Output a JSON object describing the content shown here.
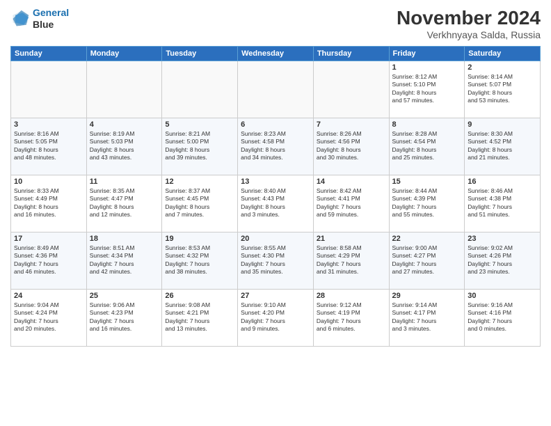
{
  "header": {
    "logo_line1": "General",
    "logo_line2": "Blue",
    "title": "November 2024",
    "subtitle": "Verkhnyaya Salda, Russia"
  },
  "weekdays": [
    "Sunday",
    "Monday",
    "Tuesday",
    "Wednesday",
    "Thursday",
    "Friday",
    "Saturday"
  ],
  "weeks": [
    [
      {
        "day": "",
        "info": ""
      },
      {
        "day": "",
        "info": ""
      },
      {
        "day": "",
        "info": ""
      },
      {
        "day": "",
        "info": ""
      },
      {
        "day": "",
        "info": ""
      },
      {
        "day": "1",
        "info": "Sunrise: 8:12 AM\nSunset: 5:10 PM\nDaylight: 8 hours\nand 57 minutes."
      },
      {
        "day": "2",
        "info": "Sunrise: 8:14 AM\nSunset: 5:07 PM\nDaylight: 8 hours\nand 53 minutes."
      }
    ],
    [
      {
        "day": "3",
        "info": "Sunrise: 8:16 AM\nSunset: 5:05 PM\nDaylight: 8 hours\nand 48 minutes."
      },
      {
        "day": "4",
        "info": "Sunrise: 8:19 AM\nSunset: 5:03 PM\nDaylight: 8 hours\nand 43 minutes."
      },
      {
        "day": "5",
        "info": "Sunrise: 8:21 AM\nSunset: 5:00 PM\nDaylight: 8 hours\nand 39 minutes."
      },
      {
        "day": "6",
        "info": "Sunrise: 8:23 AM\nSunset: 4:58 PM\nDaylight: 8 hours\nand 34 minutes."
      },
      {
        "day": "7",
        "info": "Sunrise: 8:26 AM\nSunset: 4:56 PM\nDaylight: 8 hours\nand 30 minutes."
      },
      {
        "day": "8",
        "info": "Sunrise: 8:28 AM\nSunset: 4:54 PM\nDaylight: 8 hours\nand 25 minutes."
      },
      {
        "day": "9",
        "info": "Sunrise: 8:30 AM\nSunset: 4:52 PM\nDaylight: 8 hours\nand 21 minutes."
      }
    ],
    [
      {
        "day": "10",
        "info": "Sunrise: 8:33 AM\nSunset: 4:49 PM\nDaylight: 8 hours\nand 16 minutes."
      },
      {
        "day": "11",
        "info": "Sunrise: 8:35 AM\nSunset: 4:47 PM\nDaylight: 8 hours\nand 12 minutes."
      },
      {
        "day": "12",
        "info": "Sunrise: 8:37 AM\nSunset: 4:45 PM\nDaylight: 8 hours\nand 7 minutes."
      },
      {
        "day": "13",
        "info": "Sunrise: 8:40 AM\nSunset: 4:43 PM\nDaylight: 8 hours\nand 3 minutes."
      },
      {
        "day": "14",
        "info": "Sunrise: 8:42 AM\nSunset: 4:41 PM\nDaylight: 7 hours\nand 59 minutes."
      },
      {
        "day": "15",
        "info": "Sunrise: 8:44 AM\nSunset: 4:39 PM\nDaylight: 7 hours\nand 55 minutes."
      },
      {
        "day": "16",
        "info": "Sunrise: 8:46 AM\nSunset: 4:38 PM\nDaylight: 7 hours\nand 51 minutes."
      }
    ],
    [
      {
        "day": "17",
        "info": "Sunrise: 8:49 AM\nSunset: 4:36 PM\nDaylight: 7 hours\nand 46 minutes."
      },
      {
        "day": "18",
        "info": "Sunrise: 8:51 AM\nSunset: 4:34 PM\nDaylight: 7 hours\nand 42 minutes."
      },
      {
        "day": "19",
        "info": "Sunrise: 8:53 AM\nSunset: 4:32 PM\nDaylight: 7 hours\nand 38 minutes."
      },
      {
        "day": "20",
        "info": "Sunrise: 8:55 AM\nSunset: 4:30 PM\nDaylight: 7 hours\nand 35 minutes."
      },
      {
        "day": "21",
        "info": "Sunrise: 8:58 AM\nSunset: 4:29 PM\nDaylight: 7 hours\nand 31 minutes."
      },
      {
        "day": "22",
        "info": "Sunrise: 9:00 AM\nSunset: 4:27 PM\nDaylight: 7 hours\nand 27 minutes."
      },
      {
        "day": "23",
        "info": "Sunrise: 9:02 AM\nSunset: 4:26 PM\nDaylight: 7 hours\nand 23 minutes."
      }
    ],
    [
      {
        "day": "24",
        "info": "Sunrise: 9:04 AM\nSunset: 4:24 PM\nDaylight: 7 hours\nand 20 minutes."
      },
      {
        "day": "25",
        "info": "Sunrise: 9:06 AM\nSunset: 4:23 PM\nDaylight: 7 hours\nand 16 minutes."
      },
      {
        "day": "26",
        "info": "Sunrise: 9:08 AM\nSunset: 4:21 PM\nDaylight: 7 hours\nand 13 minutes."
      },
      {
        "day": "27",
        "info": "Sunrise: 9:10 AM\nSunset: 4:20 PM\nDaylight: 7 hours\nand 9 minutes."
      },
      {
        "day": "28",
        "info": "Sunrise: 9:12 AM\nSunset: 4:19 PM\nDaylight: 7 hours\nand 6 minutes."
      },
      {
        "day": "29",
        "info": "Sunrise: 9:14 AM\nSunset: 4:17 PM\nDaylight: 7 hours\nand 3 minutes."
      },
      {
        "day": "30",
        "info": "Sunrise: 9:16 AM\nSunset: 4:16 PM\nDaylight: 7 hours\nand 0 minutes."
      }
    ]
  ]
}
